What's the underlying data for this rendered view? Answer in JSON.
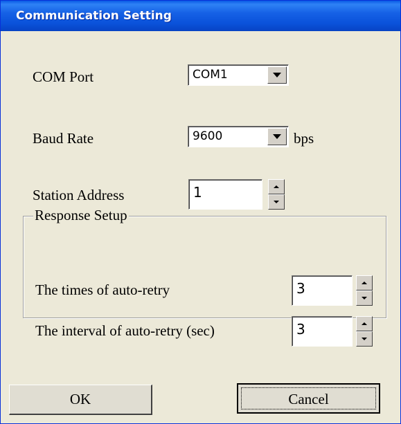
{
  "window": {
    "title": "Communication Setting"
  },
  "fields": {
    "com_port": {
      "label": "COM Port",
      "value": "COM1"
    },
    "baud_rate": {
      "label": "Baud Rate",
      "value": "9600",
      "unit": "bps"
    },
    "station_address": {
      "label": "Station Address",
      "value": "1"
    }
  },
  "response_setup": {
    "title": "Response Setup",
    "retry_times": {
      "label": "The times of auto-retry",
      "value": "3"
    },
    "retry_interval": {
      "label": "The interval of auto-retry (sec)",
      "value": "3"
    }
  },
  "buttons": {
    "ok": "OK",
    "cancel": "Cancel"
  },
  "colors": {
    "titlebar": "#0a52da",
    "background": "#ece9d8"
  }
}
